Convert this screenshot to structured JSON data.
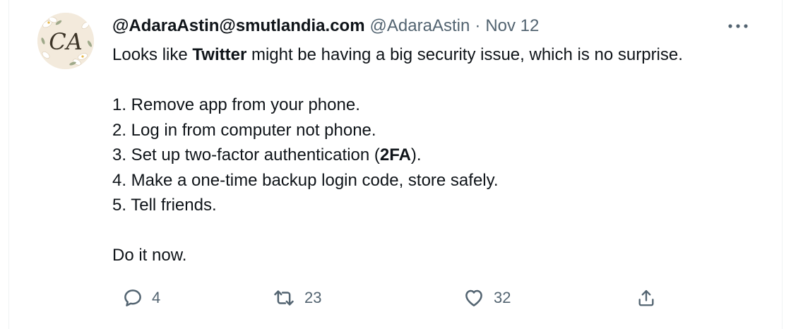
{
  "tweet": {
    "avatar_monogram": "CA",
    "display_name": "@AdaraAstin@smutlandia.com",
    "handle": "@AdaraAstin",
    "separator": "·",
    "date": "Nov 12",
    "more_icon": "ellipsis-horizontal-icon",
    "body": {
      "intro_pre": "Looks like ",
      "intro_bold": "Twitter",
      "intro_post": " might be having a big security issue, which is no surprise.",
      "step1": "1. Remove app from your phone.",
      "step2": "2. Log in from computer not phone.",
      "step3_pre": "3. Set up two-factor authentication (",
      "step3_bold": "2FA",
      "step3_post": ").",
      "step4": "4. Make a one-time backup login code, store safely.",
      "step5": "5. Tell friends.",
      "closing": "Do it now."
    },
    "actions": {
      "reply": {
        "icon": "reply-icon",
        "count": "4"
      },
      "retweet": {
        "icon": "retweet-icon",
        "count": "23"
      },
      "like": {
        "icon": "heart-icon",
        "count": "32"
      },
      "share": {
        "icon": "share-icon"
      }
    },
    "colors": {
      "text": "#0f1419",
      "secondary": "#536471",
      "border": "#eff3f4"
    }
  }
}
